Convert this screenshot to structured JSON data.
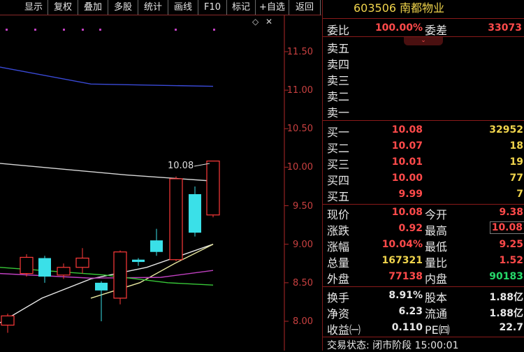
{
  "toolbar": {
    "buttons": [
      "显示",
      "复权",
      "叠加",
      "多股",
      "统计",
      "画线",
      "F10",
      "标记",
      "+自选",
      "返回"
    ]
  },
  "chart": {
    "price_tags": [
      "11.50",
      "11.00",
      "10.50",
      "10.00",
      "9.50",
      "9.00",
      "8.50",
      "8.00"
    ],
    "high_label": "10.08",
    "controls": [
      "◇",
      "✕"
    ]
  },
  "chart_data": {
    "type": "candlestick",
    "y_ticks": [
      11.5,
      11.0,
      10.5,
      10.0,
      9.5,
      9.0,
      8.5,
      8.0
    ],
    "ylim": [
      7.9,
      11.9
    ],
    "candles": [
      {
        "open": 7.95,
        "close": 8.07,
        "high": 8.1,
        "low": 7.85,
        "dir": "up"
      },
      {
        "open": 8.62,
        "close": 8.83,
        "high": 8.87,
        "low": 8.58,
        "dir": "up"
      },
      {
        "open": 8.82,
        "close": 8.58,
        "high": 8.85,
        "low": 8.5,
        "dir": "down"
      },
      {
        "open": 8.6,
        "close": 8.7,
        "high": 8.75,
        "low": 8.55,
        "dir": "up"
      },
      {
        "open": 8.7,
        "close": 8.82,
        "high": 8.95,
        "low": 8.62,
        "dir": "up"
      },
      {
        "open": 8.5,
        "close": 8.4,
        "high": 8.52,
        "low": 8.0,
        "dir": "down"
      },
      {
        "open": 8.3,
        "close": 8.9,
        "high": 8.92,
        "low": 8.22,
        "dir": "up"
      },
      {
        "open": 8.8,
        "close": 8.77,
        "high": 8.82,
        "low": 8.72,
        "dir": "down"
      },
      {
        "open": 9.05,
        "close": 8.9,
        "high": 9.2,
        "low": 8.85,
        "dir": "down"
      },
      {
        "open": 8.8,
        "close": 9.85,
        "high": 9.88,
        "low": 8.78,
        "dir": "up"
      },
      {
        "open": 9.65,
        "close": 9.15,
        "high": 9.75,
        "low": 9.1,
        "dir": "down"
      },
      {
        "open": 9.38,
        "close": 10.08,
        "high": 10.08,
        "low": 9.35,
        "dir": "up"
      }
    ],
    "ma_lines": [
      {
        "color": "#d8d8d8",
        "values": [
          10.05,
          9.9,
          9.82
        ]
      },
      {
        "color": "#3a4ad8",
        "values": [
          11.3,
          11.08,
          11.05
        ]
      },
      {
        "color": "#e8e8e8",
        "values": [
          7.98,
          8.3,
          8.55,
          8.7,
          9.0
        ]
      },
      {
        "color": "#e8e8a0",
        "values": [
          8.3,
          8.5,
          8.75,
          9.0
        ]
      },
      {
        "color": "#c040c0",
        "values": [
          8.62,
          8.56,
          8.57,
          8.66
        ]
      },
      {
        "color": "#38c838",
        "values": [
          8.7,
          8.6,
          8.5,
          8.47
        ]
      }
    ]
  },
  "panel": {
    "code": "603506",
    "name": "南都物业",
    "weibi_label": "委比",
    "weibi_value": "100.00%",
    "weicha_label": "委差",
    "weicha_value": "33073",
    "sell": [
      {
        "label": "卖五",
        "price": "",
        "vol": ""
      },
      {
        "label": "卖四",
        "price": "",
        "vol": ""
      },
      {
        "label": "卖三",
        "price": "",
        "vol": ""
      },
      {
        "label": "卖二",
        "price": "",
        "vol": ""
      },
      {
        "label": "卖一",
        "price": "",
        "vol": ""
      }
    ],
    "buy": [
      {
        "label": "买一",
        "price": "10.08",
        "vol": "32952"
      },
      {
        "label": "买二",
        "price": "10.07",
        "vol": "18"
      },
      {
        "label": "买三",
        "price": "10.01",
        "vol": "19"
      },
      {
        "label": "买四",
        "price": "10.00",
        "vol": "77"
      },
      {
        "label": "买五",
        "price": "9.99",
        "vol": "7"
      }
    ],
    "stats": [
      {
        "l1": "现价",
        "v1": "10.08",
        "c1": "red",
        "l2": "今开",
        "v2": "9.38",
        "c2": "red"
      },
      {
        "l1": "涨跌",
        "v1": "0.92",
        "c1": "red",
        "l2": "最高",
        "v2": "10.08",
        "c2": "red"
      },
      {
        "l1": "涨幅",
        "v1": "10.04%",
        "c1": "red",
        "l2": "最低",
        "v2": "9.25",
        "c2": "red"
      },
      {
        "l1": "总量",
        "v1": "167321",
        "c1": "yellow",
        "l2": "量比",
        "v2": "1.52",
        "c2": "red"
      },
      {
        "l1": "外盘",
        "v1": "77138",
        "c1": "red",
        "l2": "内盘",
        "v2": "90183",
        "c2": "green"
      }
    ],
    "stats2": [
      {
        "l1": "换手",
        "v1": "8.91%",
        "l2": "股本",
        "v2": "1.88亿"
      },
      {
        "l1": "净资",
        "v1": "6.23",
        "l2": "流通",
        "v2": "1.88亿"
      },
      {
        "l1": "收益㈠",
        "v1": "0.110",
        "l2": "PE㈣",
        "v2": "22.7"
      }
    ],
    "status": "交易状态: 闭市阶段 15:00:01"
  },
  "colors": {
    "up": "#ff3a3a",
    "down": "#3ae0e8",
    "title": "#f0d44c",
    "divider": "#8a1a1a"
  }
}
